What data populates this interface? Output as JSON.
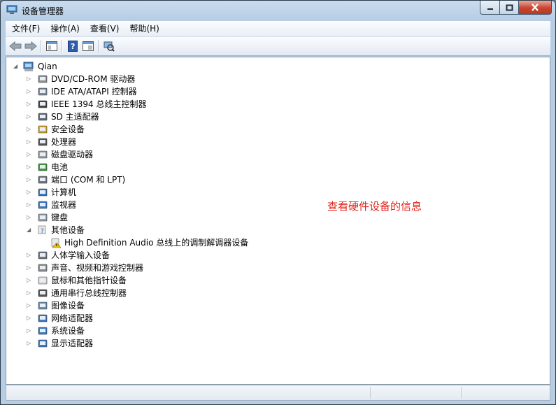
{
  "window": {
    "title": "设备管理器"
  },
  "menu": [
    "文件(F)",
    "操作(A)",
    "查看(V)",
    "帮助(H)"
  ],
  "toolbar": {
    "buttons": [
      "back-icon",
      "forward-icon",
      "properties-panel-icon",
      "help-icon",
      "view-toggle-icon",
      "scan-hardware-icon"
    ]
  },
  "tree": {
    "root": "Qian",
    "items": [
      {
        "label": "DVD/CD-ROM 驱动器",
        "icon": "dvd-drive-icon",
        "expanded": false
      },
      {
        "label": "IDE ATA/ATAPI 控制器",
        "icon": "ide-controller-icon",
        "expanded": false
      },
      {
        "label": "IEEE 1394 总线主控制器",
        "icon": "ieee1394-icon",
        "expanded": false
      },
      {
        "label": "SD 主适配器",
        "icon": "sd-adapter-icon",
        "expanded": false
      },
      {
        "label": "安全设备",
        "icon": "security-device-icon",
        "expanded": false
      },
      {
        "label": "处理器",
        "icon": "processor-icon",
        "expanded": false
      },
      {
        "label": "磁盘驱动器",
        "icon": "disk-drive-icon",
        "expanded": false
      },
      {
        "label": "电池",
        "icon": "battery-icon",
        "expanded": false
      },
      {
        "label": "端口 (COM 和 LPT)",
        "icon": "port-icon",
        "expanded": false
      },
      {
        "label": "计算机",
        "icon": "computer-icon",
        "expanded": false
      },
      {
        "label": "监视器",
        "icon": "monitor-icon",
        "expanded": false
      },
      {
        "label": "键盘",
        "icon": "keyboard-icon",
        "expanded": false
      },
      {
        "label": "其他设备",
        "icon": "other-devices-icon",
        "expanded": true,
        "children": [
          {
            "label": "High Definition Audio 总线上的调制解调器设备",
            "icon": "warning-device-icon"
          }
        ]
      },
      {
        "label": "人体学输入设备",
        "icon": "hid-icon",
        "expanded": false
      },
      {
        "label": "声音、视频和游戏控制器",
        "icon": "sound-icon",
        "expanded": false
      },
      {
        "label": "鼠标和其他指针设备",
        "icon": "mouse-icon",
        "expanded": false
      },
      {
        "label": "通用串行总线控制器",
        "icon": "usb-icon",
        "expanded": false
      },
      {
        "label": "图像设备",
        "icon": "imaging-icon",
        "expanded": false
      },
      {
        "label": "网络适配器",
        "icon": "network-adapter-icon",
        "expanded": false
      },
      {
        "label": "系统设备",
        "icon": "system-device-icon",
        "expanded": false
      },
      {
        "label": "显示适配器",
        "icon": "display-adapter-icon",
        "expanded": false
      }
    ]
  },
  "annotation": "查看硬件设备的信息",
  "colors": {
    "annotation": "#e2231a",
    "warning": "#f2c200"
  }
}
